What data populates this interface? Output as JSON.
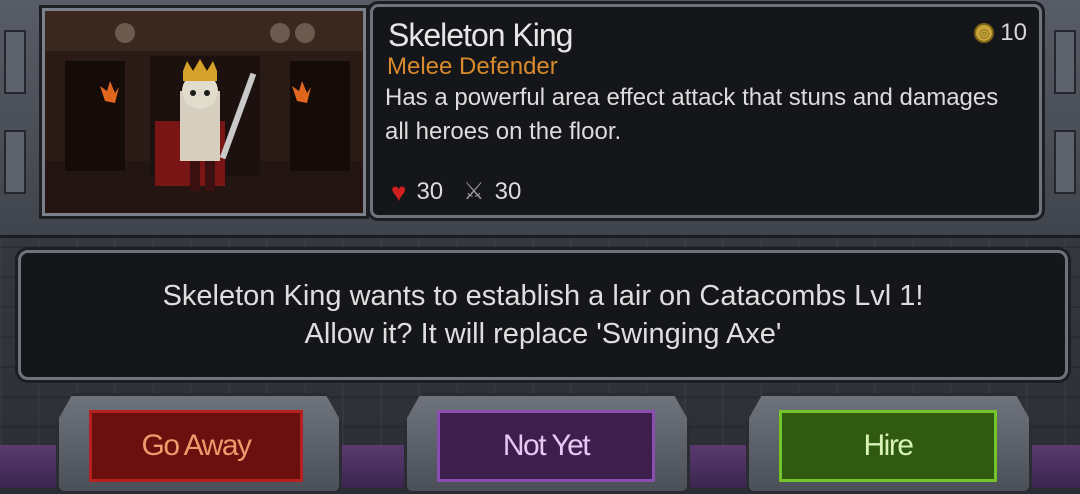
{
  "unit": {
    "name": "Skeleton King",
    "role": "Melee Defender",
    "description": "Has a powerful area effect attack that stuns and damages all heroes on the floor.",
    "cost": "10",
    "health": "30",
    "attack": "30"
  },
  "message": {
    "line1": "Skeleton King wants to establish a lair on Catacombs Lvl 1!",
    "line2": "Allow it? It will replace 'Swinging Axe'"
  },
  "buttons": {
    "go_away": "Go Away",
    "not_yet": "Not Yet",
    "hire": "Hire"
  },
  "icons": {
    "cost": "coin-icon",
    "health": "heart-icon",
    "attack": "sword-icon"
  },
  "colors": {
    "role": "#d88a2c",
    "go_away": "#6b0f0f",
    "not_yet": "#3c1f4d",
    "hire": "#2f5a0f"
  }
}
